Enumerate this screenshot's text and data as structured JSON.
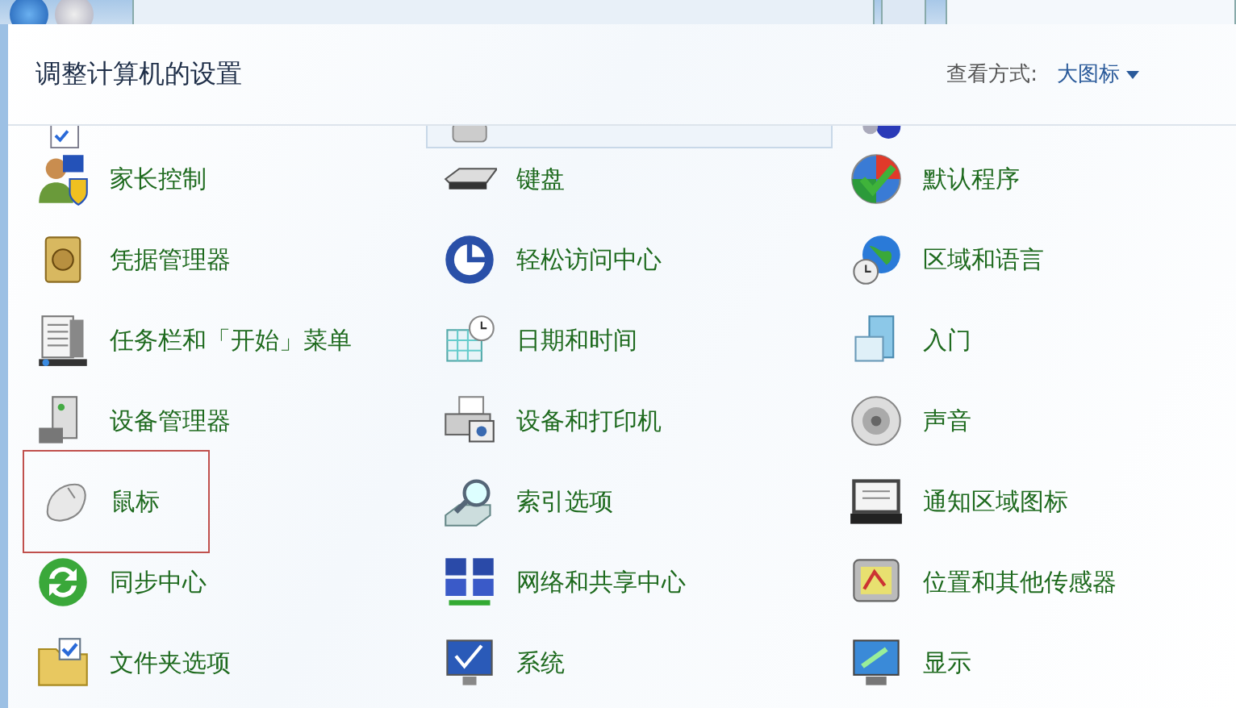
{
  "header": {
    "title": "调整计算机的设置",
    "view_label": "查看方式:",
    "view_value": "大图标"
  },
  "top_row": [
    {
      "selected": false
    },
    {
      "selected": true
    },
    {
      "selected": false
    }
  ],
  "items": [
    {
      "label": "家长控制",
      "highlighted": false
    },
    {
      "label": "键盘",
      "highlighted": false
    },
    {
      "label": "默认程序",
      "highlighted": false
    },
    {
      "label": "凭据管理器",
      "highlighted": false
    },
    {
      "label": "轻松访问中心",
      "highlighted": false
    },
    {
      "label": "区域和语言",
      "highlighted": false
    },
    {
      "label": "任务栏和「开始」菜单",
      "highlighted": false
    },
    {
      "label": "日期和时间",
      "highlighted": false
    },
    {
      "label": "入门",
      "highlighted": false
    },
    {
      "label": "设备管理器",
      "highlighted": false
    },
    {
      "label": "设备和打印机",
      "highlighted": false
    },
    {
      "label": "声音",
      "highlighted": false
    },
    {
      "label": "鼠标",
      "highlighted": true
    },
    {
      "label": "索引选项",
      "highlighted": false
    },
    {
      "label": "通知区域图标",
      "highlighted": false
    },
    {
      "label": "同步中心",
      "highlighted": false
    },
    {
      "label": "网络和共享中心",
      "highlighted": false
    },
    {
      "label": "位置和其他传感器",
      "highlighted": false
    },
    {
      "label": "文件夹选项",
      "highlighted": false
    },
    {
      "label": "系统",
      "highlighted": false
    },
    {
      "label": "显示",
      "highlighted": false
    }
  ]
}
